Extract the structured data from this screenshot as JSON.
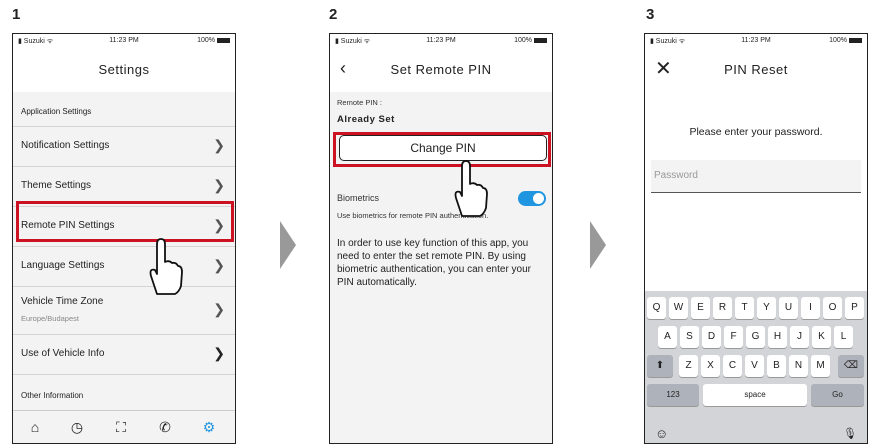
{
  "steps": [
    "1",
    "2",
    "3"
  ],
  "status": {
    "carrier": "Suzuki",
    "time": "11:23 PM",
    "battery": "100%"
  },
  "screen1": {
    "title": "Settings",
    "section_app": "Application Settings",
    "items": [
      {
        "label": "Notification Settings"
      },
      {
        "label": "Theme Settings"
      },
      {
        "label": "Remote PIN Settings"
      },
      {
        "label": "Language Settings"
      },
      {
        "label": "Vehicle Time Zone",
        "sub": "Europe/Budapest"
      },
      {
        "label": "Use of Vehicle Info"
      }
    ],
    "section_other": "Other Information",
    "tabs": [
      "home-icon",
      "history-icon",
      "map-icon",
      "phone-icon",
      "gear-icon"
    ]
  },
  "screen2": {
    "title": "Set Remote PIN",
    "pin_label": "Remote PIN :",
    "pin_value": "Already Set",
    "change_button": "Change PIN",
    "biometrics_label": "Biometrics",
    "biometrics_on": true,
    "biometrics_desc": "Use biometrics for remote PIN authentication.",
    "info_text": "In order to use key function of this app, you need to enter the set remote PIN. By using biometric authentication, you can enter your PIN automatically."
  },
  "screen3": {
    "title": "PIN Reset",
    "prompt": "Please enter your password.",
    "password_placeholder": "Password",
    "keyboard": {
      "row1": [
        "Q",
        "W",
        "E",
        "R",
        "T",
        "Y",
        "U",
        "I",
        "O",
        "P"
      ],
      "row2": [
        "A",
        "S",
        "D",
        "F",
        "G",
        "H",
        "J",
        "K",
        "L"
      ],
      "row3": [
        "Z",
        "X",
        "C",
        "V",
        "B",
        "N",
        "M"
      ],
      "num_key": "123",
      "space_key": "space",
      "go_key": "Go"
    }
  },
  "colors": {
    "highlight": "#cc1122",
    "accent": "#2196e0"
  }
}
